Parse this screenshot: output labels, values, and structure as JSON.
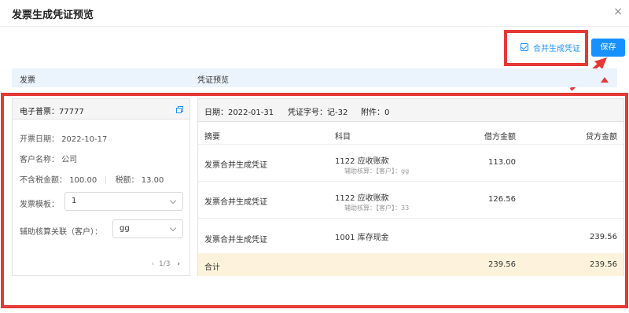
{
  "dialog": {
    "title": "发票生成凭证预览",
    "close_icon": "×"
  },
  "toolbar": {
    "merge_label": "合并生成凭证",
    "merge_checked": true,
    "save_label": "保存"
  },
  "sections": {
    "invoice": "发票",
    "preview": "凭证预览"
  },
  "invoice": {
    "number": "电子普票：77777",
    "date_label": "开票日期：",
    "date_value": "2022-10-17",
    "customer_label": "客户名称：",
    "customer_value": "公司",
    "pretax_label": "不含税金额：",
    "pretax_value": "100.00",
    "tax_label": "税额：",
    "tax_value": "13.00",
    "template_label": "发票模板：",
    "template_value": "1",
    "aux_label": "辅助核算关联（客户）：",
    "aux_value": "gg",
    "pager": "1/3"
  },
  "voucher": {
    "date_label": "日期：",
    "date_value": "2022-01-31",
    "number_label": "凭证字号：",
    "number_value": "记-32",
    "attach_label": "附件：",
    "attach_value": "0",
    "columns": {
      "summary": "摘要",
      "subject": "科目",
      "debit": "借方金额",
      "credit": "贷方金额"
    },
    "rows": [
      {
        "summary": "发票合并生成凭证",
        "subject": "1122 应收账款",
        "aux": "辅助核算：【客户】：gg",
        "debit": "113.00",
        "credit": ""
      },
      {
        "summary": "发票合并生成凭证",
        "subject": "1122 应收账款",
        "aux": "辅助核算：【客户】：33",
        "debit": "126.56",
        "credit": ""
      },
      {
        "summary": "发票合并生成凭证",
        "subject": "1001 库存现金",
        "aux": "",
        "debit": "",
        "credit": "239.56"
      }
    ],
    "total": {
      "label": "合计",
      "debit": "239.56",
      "credit": "239.56"
    }
  },
  "colors": {
    "accent": "#1890ff",
    "annotation_red": "#e53935",
    "section_bg": "#ebf3fd",
    "total_bg": "#fdf3dc"
  }
}
